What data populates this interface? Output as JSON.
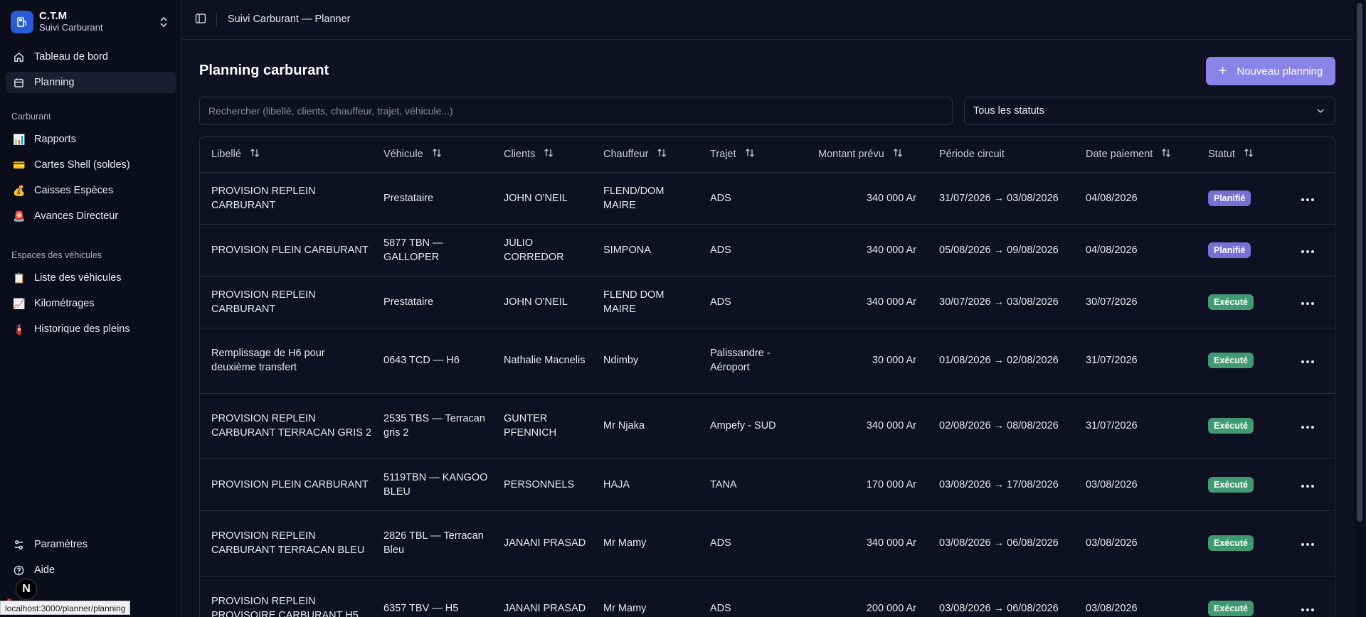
{
  "brand": {
    "name": "C.T.M",
    "subtitle": "Suivi Carburant"
  },
  "nav": {
    "main": [
      {
        "label": "Tableau de bord",
        "icon": "home-icon",
        "active": false
      },
      {
        "label": "Planning",
        "icon": "calendar-icon",
        "active": true
      }
    ],
    "carburant_section": "Carburant",
    "carburant": [
      {
        "label": "Rapports",
        "icon": "📊"
      },
      {
        "label": "Cartes Shell (soldes)",
        "icon": "💳"
      },
      {
        "label": "Caisses Espèces",
        "icon": "💰"
      },
      {
        "label": "Avances Directeur",
        "icon": "🚨"
      }
    ],
    "vehicules_section": "Espaces des véhicules",
    "vehicules": [
      {
        "label": "Liste des véhicules",
        "icon": "📋"
      },
      {
        "label": "Kilométrages",
        "icon": "📈"
      },
      {
        "label": "Historique des pleins",
        "icon": "🧯"
      }
    ],
    "bottom": [
      {
        "label": "Paramètres",
        "icon": "settings-icon"
      },
      {
        "label": "Aide",
        "icon": "help-icon"
      }
    ]
  },
  "status_bar_url": "localhost:3000/planner/planning",
  "next_badge": "N",
  "topbar": {
    "title": "Suivi Carburant — Planner"
  },
  "page": {
    "title": "Planning carburant",
    "new_button": "Nouveau planning",
    "search_placeholder": "Rechercher (libellé, clients, chauffeur, trajet, véhicule...)",
    "status_filter": "Tous les statuts"
  },
  "table": {
    "headers": {
      "libelle": "Libellé",
      "vehicule": "Véhicule",
      "clients": "Clients",
      "chauffeur": "Chauffeur",
      "trajet": "Trajet",
      "montant": "Montant prévu",
      "periode": "Période circuit",
      "date_paiement": "Date paiement",
      "statut": "Statut"
    },
    "rows": [
      {
        "libelle": "PROVISION REPLEIN CARBURANT",
        "vehicule": "Prestataire",
        "clients": "JOHN O'NEIL",
        "chauffeur": "FLEND/DOM MAIRE",
        "trajet": "ADS",
        "montant": "340 000 Ar",
        "periode": "31/07/2026 → 03/08/2026",
        "date_paiement": "04/08/2026",
        "statut": "Planifié",
        "statut_kind": "planifie"
      },
      {
        "libelle": "PROVISION PLEIN CARBURANT",
        "vehicule": "5877 TBN — GALLOPER",
        "clients": "JULIO CORREDOR",
        "chauffeur": "SIMPONA",
        "trajet": "ADS",
        "montant": "340 000 Ar",
        "periode": "05/08/2026 → 09/08/2026",
        "date_paiement": "04/08/2026",
        "statut": "Planifié",
        "statut_kind": "planifie"
      },
      {
        "libelle": "PROVISION REPLEIN CARBURANT",
        "vehicule": "Prestataire",
        "clients": "JOHN O'NEIL",
        "chauffeur": "FLEND DOM MAIRE",
        "trajet": "ADS",
        "montant": "340 000 Ar",
        "periode": "30/07/2026 → 03/08/2026",
        "date_paiement": "30/07/2026",
        "statut": "Exécuté",
        "statut_kind": "execute"
      },
      {
        "libelle": "Remplissage de H6 pour deuxième transfert",
        "vehicule": "0643 TCD — H6",
        "clients": "Nathalie Macnelis",
        "chauffeur": "Ndimby",
        "trajet": "Palissandre - Aéroport",
        "montant": "30 000 Ar",
        "periode": "01/08/2026 → 02/08/2026",
        "date_paiement": "31/07/2026",
        "statut": "Exécuté",
        "statut_kind": "execute"
      },
      {
        "libelle": "PROVISION REPLEIN CARBURANT TERRACAN GRIS 2",
        "vehicule": "2535 TBS — Terracan gris 2",
        "clients": "GUNTER PFENNICH",
        "chauffeur": "Mr Njaka",
        "trajet": "Ampefy - SUD",
        "montant": "340 000 Ar",
        "periode": "02/08/2026 → 08/08/2026",
        "date_paiement": "31/07/2026",
        "statut": "Exécuté",
        "statut_kind": "execute"
      },
      {
        "libelle": "PROVISION PLEIN CARBURANT",
        "vehicule": "5119TBN — KANGOO BLEU",
        "clients": "PERSONNELS",
        "chauffeur": "HAJA",
        "trajet": "TANA",
        "montant": "170 000 Ar",
        "periode": "03/08/2026 → 17/08/2026",
        "date_paiement": "03/08/2026",
        "statut": "Exécuté",
        "statut_kind": "execute"
      },
      {
        "libelle": "PROVISION REPLEIN CARBURANT TERRACAN BLEU",
        "vehicule": "2826 TBL — Terracan Bleu",
        "clients": "JANANI PRASAD",
        "chauffeur": "Mr Mamy",
        "trajet": "ADS",
        "montant": "340 000 Ar",
        "periode": "03/08/2026 → 06/08/2026",
        "date_paiement": "03/08/2026",
        "statut": "Exécuté",
        "statut_kind": "execute"
      },
      {
        "libelle": "PROVISION REPLEIN PROVISOIRE CARBURANT H5",
        "vehicule": "6357 TBV — H5",
        "clients": "JANANI PRASAD",
        "chauffeur": "Mr Mamy",
        "trajet": "ADS",
        "montant": "200 000 Ar",
        "periode": "03/08/2026 → 06/08/2026",
        "date_paiement": "03/08/2026",
        "statut": "Exécuté",
        "statut_kind": "execute"
      }
    ]
  },
  "colors": {
    "background": "#0f1021",
    "accent": "#8b84e8",
    "planifie": "#7b6fd6",
    "execute": "#3f9a72"
  }
}
